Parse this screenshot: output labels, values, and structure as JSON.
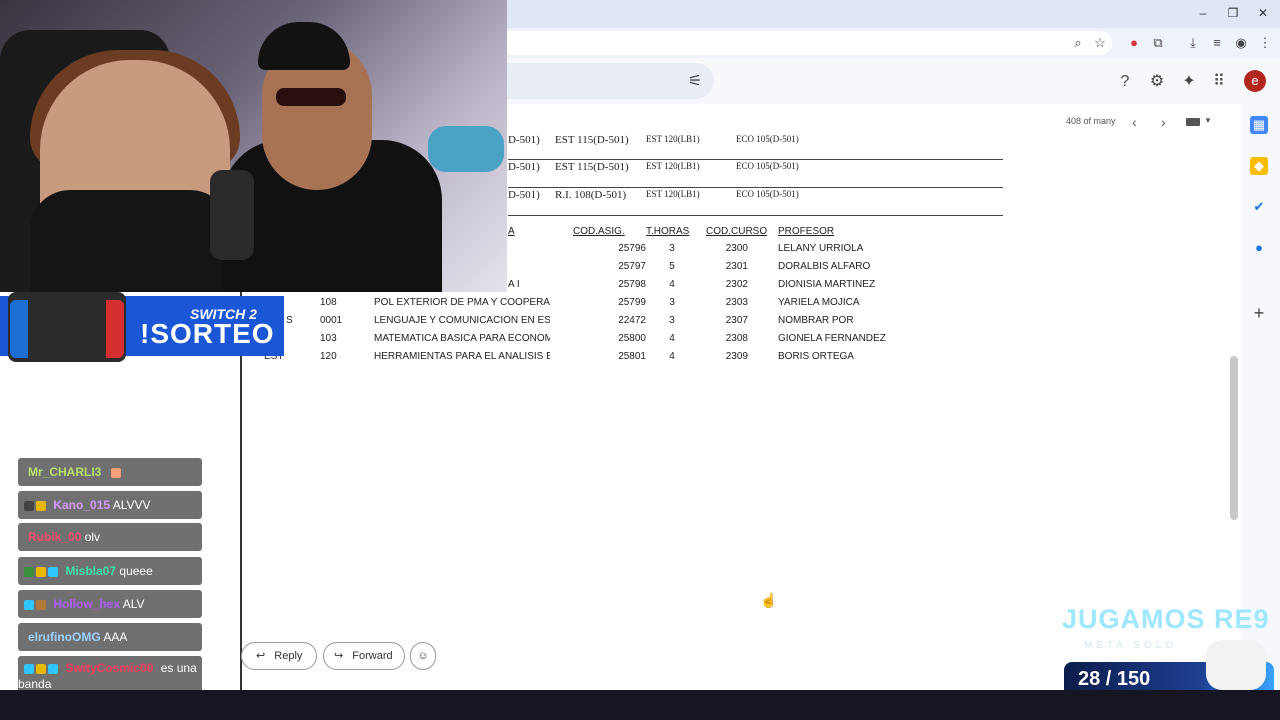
{
  "browser": {
    "window_controls": [
      "–",
      "❐",
      "✕"
    ]
  },
  "gmail": {
    "pager": "408 of many",
    "avatar_initial": "e",
    "reply_label": "Reply",
    "forward_label": "Forward"
  },
  "schedule": {
    "upper_rows": [
      {
        "c0": "D-501)",
        "c1": "EST 115(D-501)",
        "c2": "EST 120(LB1)",
        "c3": "ECO 105(D-501)"
      },
      {
        "c0": "D-501)",
        "c1": "EST 115(D-501)",
        "c2": "EST 120(LB1)",
        "c3": "ECO 105(D-501)"
      },
      {
        "c0": "D-501)",
        "c1": "R.I. 108(D-501)",
        "c2": "EST 120(LB1)",
        "c3": "ECO 105(D-501)"
      }
    ],
    "headers": {
      "name_tail": "A",
      "cod_asig": "COD.ASIG.",
      "t_horas": "T.HORAS",
      "cod_curso": "COD.CURSO",
      "profesor": "PROFESOR"
    },
    "rows": [
      {
        "prefix": "",
        "code": "",
        "name": "",
        "asig": "25796",
        "horas": "3",
        "curso": "2300",
        "prof": "LELANY URRIOLA"
      },
      {
        "prefix": "",
        "code": "",
        "name": "",
        "asig": "25797",
        "horas": "5",
        "curso": "2301",
        "prof": "DORALBIS ALFARO"
      },
      {
        "prefix": "",
        "code": "",
        "name": "A I",
        "asig": "25798",
        "horas": "4",
        "curso": "2302",
        "prof": "DIONISIA MARTINEZ"
      },
      {
        "prefix": "",
        "code": "108",
        "name": "POL EXTERIOR DE PMA Y COOPERAC",
        "asig": "25799",
        "horas": "3",
        "curso": "2303",
        "prof": "YARIELA MOJICA"
      },
      {
        "prefix": "S",
        "code": "0001",
        "name": "LENGUAJE Y COMUNICACIÓN EN ESP",
        "asig": "22472",
        "horas": "3",
        "curso": "2307",
        "prof": "NOMBRAR POR"
      },
      {
        "prefix": "",
        "code": "103",
        "name": "MATEMATICA BASICA PARA ECONOM",
        "asig": "25800",
        "horas": "4",
        "curso": "2308",
        "prof": "GIONELA FERNANDEZ"
      },
      {
        "prefix": "EST",
        "code": "120",
        "name": "HERRAMIENTAS PARA EL ANALISIS E",
        "asig": "25801",
        "horas": "4",
        "curso": "2309",
        "prof": "BORIS ORTEGA"
      }
    ]
  },
  "stream": {
    "sorteo_top": "SWITCH 2",
    "sorteo_main": "!SORTEO",
    "overlay_title": "JUGAMOS RE9",
    "overlay_sub": "META SOLO",
    "counter": "28 / 150",
    "chat": [
      {
        "user": "Mr_CHARLI3",
        "msg": "",
        "color": "#b6e36a"
      },
      {
        "user": "Kano_015",
        "msg": "ALVVV",
        "color": "#d79bff"
      },
      {
        "user": "Rubik_00",
        "msg": "olv",
        "color": "#ff4b6e"
      },
      {
        "user": "Misbla07",
        "msg": "queee",
        "color": "#3be3a6"
      },
      {
        "user": "Hollow_hex",
        "msg": "ALV",
        "color": "#b05cff"
      },
      {
        "user": "elrufinoOMG",
        "msg": "AAA",
        "color": "#9ad0ff"
      },
      {
        "user": "SwityCosmic00",
        "msg": "es una banda",
        "color": "#ff3b5c"
      }
    ]
  }
}
